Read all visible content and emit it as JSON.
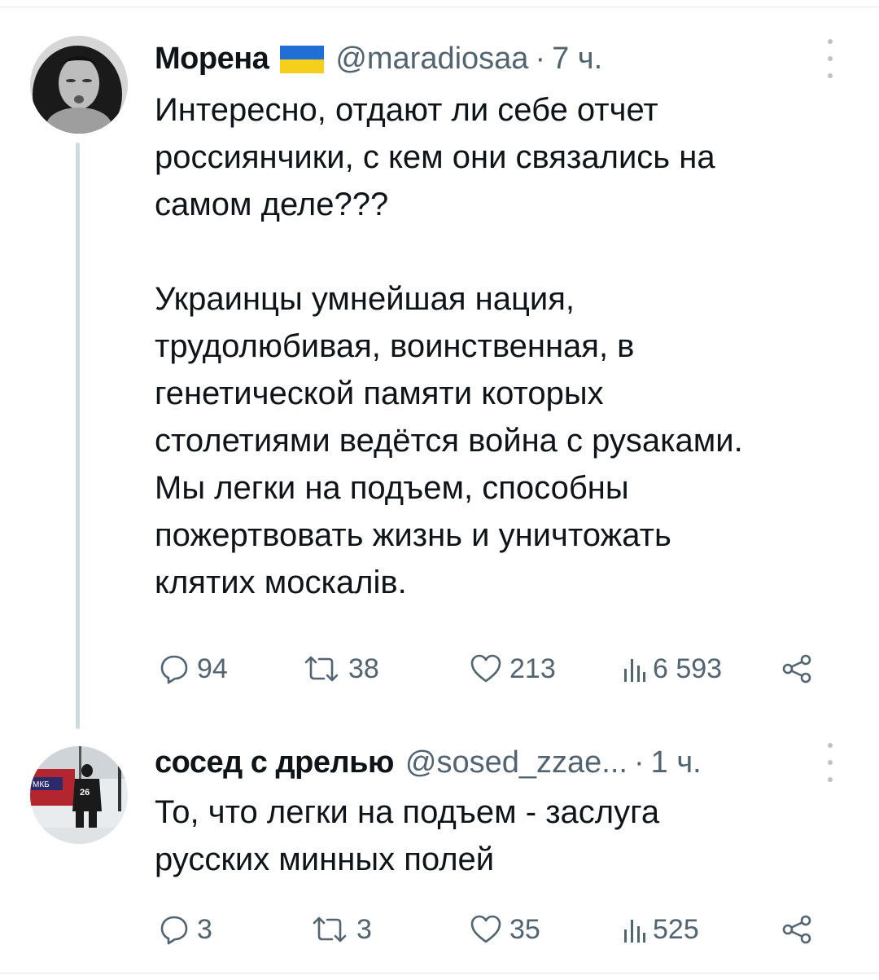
{
  "tweet1": {
    "display_name": "Морена",
    "handle": "@maradiosaa",
    "separator": "·",
    "time": "7 ч.",
    "text_lines": [
      "Интересно, отдают ли себе отчет",
      "россиянчики, с кем они связались на",
      "самом деле???",
      "",
      "Украинцы умнейшая нация,",
      "трудолюбивая, воинственная, в",
      "генетической памяти которых",
      "столетиями ведётся война с руsаками.",
      "Мы легки на подъем, способны",
      "пожертвовать жизнь и уничтожать",
      "клятих москалів."
    ],
    "replies": "94",
    "retweets": "38",
    "likes": "213",
    "views": "6 593"
  },
  "tweet2": {
    "display_name": "сосед с дрелью",
    "handle": "@sosed_zzae...",
    "separator": "·",
    "time": "1 ч.",
    "text_lines": [
      "То, что легки на подъем - заслуга",
      "русских минных полей"
    ],
    "replies": "3",
    "retweets": "3",
    "likes": "35",
    "views": "525"
  },
  "colors": {
    "text": "#0f1419",
    "secondary": "#536471",
    "thread_line": "#cfd9de",
    "flag_blue": "#1f6fd6",
    "flag_yellow": "#f5cf1b"
  },
  "icons": {
    "reply": "reply-icon",
    "retweet": "retweet-icon",
    "like": "heart-icon",
    "views": "views-icon",
    "share": "share-icon",
    "more": "more-vertical-icon"
  }
}
